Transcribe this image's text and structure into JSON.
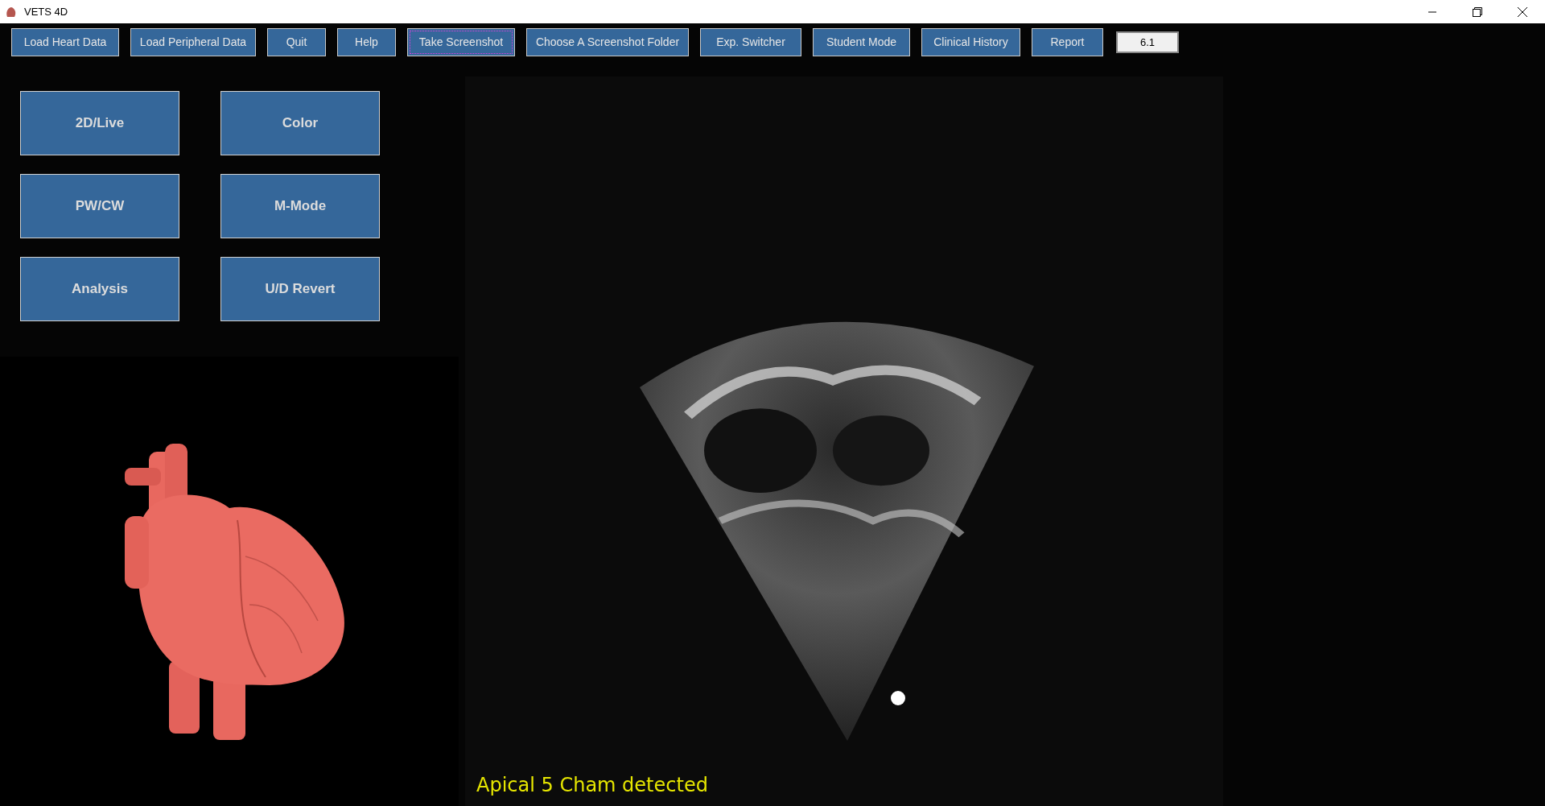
{
  "window": {
    "title": "VETS 4D"
  },
  "toolbar": [
    {
      "label": "Load Heart Data",
      "focused": false
    },
    {
      "label": "Load Peripheral Data",
      "focused": false
    },
    {
      "label": "Quit",
      "focused": false
    },
    {
      "label": "Help",
      "focused": false
    },
    {
      "label": "Take Screenshot",
      "focused": true
    },
    {
      "label": "Choose A Screenshot Folder",
      "focused": false
    },
    {
      "label": "Exp. Switcher",
      "focused": false
    },
    {
      "label": "Student Mode",
      "focused": false
    },
    {
      "label": "Clinical History",
      "focused": false
    },
    {
      "label": "Report",
      "focused": false
    }
  ],
  "version_field": {
    "value": "6.1"
  },
  "mode_buttons": [
    "2D/Live",
    "Color",
    "PW/CW",
    "M-Mode",
    "Analysis",
    "U/D Revert"
  ],
  "status": "Apical 5 Cham detected"
}
